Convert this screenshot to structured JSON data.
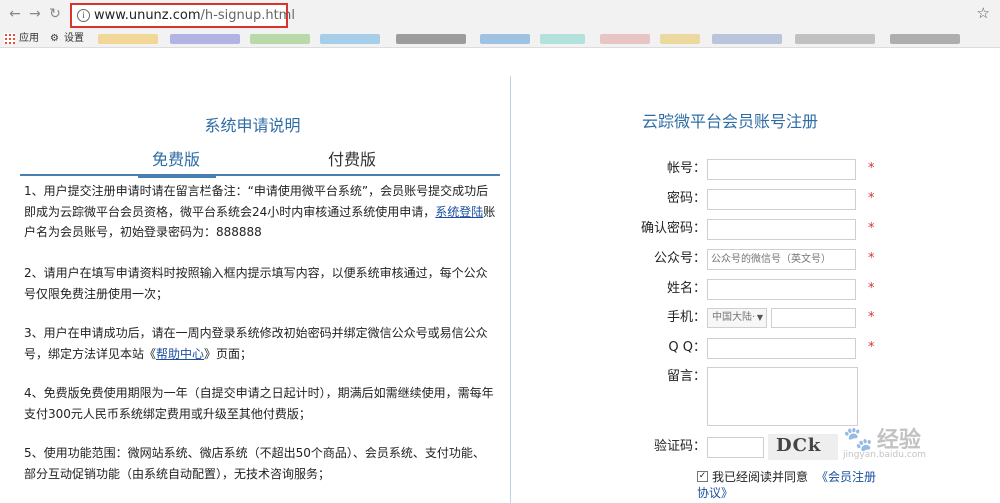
{
  "browser": {
    "url_host": "www.ununz.com",
    "url_path": "/h-signup.html",
    "bookmarks": {
      "apps": "应用",
      "settings": "设置"
    }
  },
  "left": {
    "title": "系统申请说明",
    "tabs": [
      {
        "label": "免费版"
      },
      {
        "label": "付费版"
      }
    ],
    "paragraphs": [
      {
        "pre": "1、用户提交注册申请时请在留言栏备注：“申请使用微平台系统”，会员账号提交成功后即成为云踪微平台会员资格，微平台系统会24小时内审核通过系统使用申请，",
        "link": "系统登陆",
        "post": "账户名为会员账号，初始登录密码为：888888"
      },
      {
        "pre": "2、请用户在填写申请资料时按照输入框内提示填写内容，以便系统审核通过，每个公众号仅限免费注册使用一次；",
        "link": "",
        "post": ""
      },
      {
        "pre": "3、用户在申请成功后，请在一周内登录系统修改初始密码并绑定微信公众号或易信公众号，绑定方法详见本站《",
        "link": "帮助中心",
        "post": "》页面；"
      },
      {
        "pre": "4、免费版免费使用期限为一年（自提交申请之日起计时），期满后如需继续使用，需每年支付300元人民币系统绑定费用或升级至其他付费版；",
        "link": "",
        "post": ""
      },
      {
        "pre": "5、使用功能范围：微网站系统、微店系统（不超出50个商品）、会员系统、支付功能、部分互动促销功能（由系统自动配置），无技术咨询服务；",
        "link": "",
        "post": ""
      }
    ]
  },
  "form": {
    "title": "云踪微平台会员账号注册",
    "labels": {
      "account": "帐号：",
      "password": "密码：",
      "confirm": "确认密码：",
      "official": "公众号：",
      "name": "姓名：",
      "phone": "手机：",
      "qq": "Q Q：",
      "message": "留言：",
      "captcha": "验证码："
    },
    "official_placeholder": "公众号的微信号（英文号）",
    "region_select": "中国大陆·",
    "required_mark": "*",
    "captcha_text": "DCk",
    "agree_checked": "✓",
    "agree_text": "我已经阅读并同意",
    "agree_link_a": "《会员注册",
    "agree_link_b": "协议》"
  },
  "watermark": {
    "brand": "经验",
    "sub": "jingyan.baidu.com"
  },
  "colors": {
    "accent": "#2e6da4",
    "required": "#d9342b",
    "highlight": "#d9342b"
  }
}
